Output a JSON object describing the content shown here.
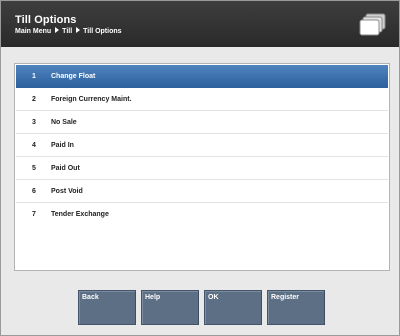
{
  "header": {
    "title": "Till Options",
    "breadcrumb": [
      "Main Menu",
      "Till",
      "Till Options"
    ],
    "icon": "stacked-documents-icon"
  },
  "menu": {
    "selected_index": 0,
    "items": [
      {
        "number": "1",
        "label": "Change Float"
      },
      {
        "number": "2",
        "label": "Foreign Currency Maint."
      },
      {
        "number": "3",
        "label": "No Sale"
      },
      {
        "number": "4",
        "label": "Paid In"
      },
      {
        "number": "5",
        "label": "Paid Out"
      },
      {
        "number": "6",
        "label": "Post Void"
      },
      {
        "number": "7",
        "label": "Tender Exchange"
      }
    ]
  },
  "buttons": {
    "back": "Back",
    "help": "Help",
    "ok": "OK",
    "register": "Register"
  },
  "colors": {
    "header": "#2f2f2f",
    "selected_row": "#3a6eab",
    "button": "#5c6f84"
  }
}
